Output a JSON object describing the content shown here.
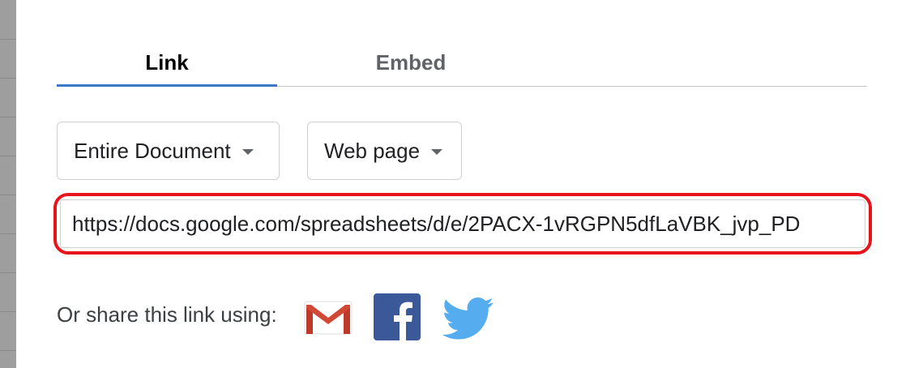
{
  "tabs": [
    {
      "label": "Link",
      "active": true
    },
    {
      "label": "Embed",
      "active": false
    }
  ],
  "publish": {
    "scope_dropdown": {
      "selected": "Entire Document"
    },
    "format_dropdown": {
      "selected": "Web page"
    }
  },
  "url_field": {
    "value": "https://docs.google.com/spreadsheets/d/e/2PACX-1vRGPN5dfLaVBK_jvp_PD"
  },
  "share": {
    "label": "Or share this link using:",
    "services": [
      {
        "name": "Gmail",
        "icon": "gmail-icon"
      },
      {
        "name": "Facebook",
        "icon": "facebook-icon"
      },
      {
        "name": "Twitter",
        "icon": "twitter-icon"
      }
    ]
  },
  "colors": {
    "tab_indicator": "#3b78c7",
    "highlight_border": "#e8141b",
    "facebook_blue": "#3b5998",
    "twitter_blue": "#55acee",
    "gmail_red": "#d14836"
  }
}
